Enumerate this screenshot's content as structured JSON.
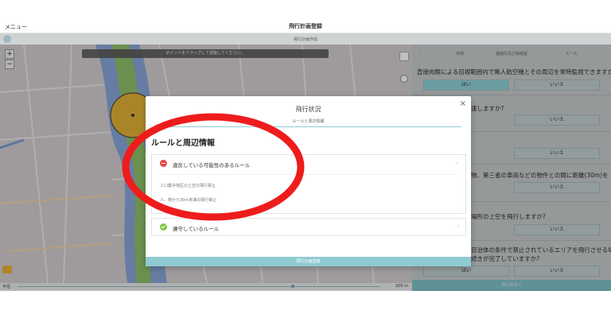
{
  "app": {
    "menu_label": "メニュー",
    "title": "飛行計画登録",
    "subheader": "飛行計画作成"
  },
  "map": {
    "hint": "ポイントをドラッグして調整してください。",
    "zoom_in": "+",
    "zoom_out": "−",
    "slider_label": "半径",
    "distance": "200 m",
    "slider_value_ratio": 0.76
  },
  "panel": {
    "tabs": [
      "日時",
      "連絡先及び操縦者",
      "ルール"
    ],
    "prev": "‹",
    "next": "›",
    "questions": [
      "直接肉眼による目視範囲内で無人航空機とその周辺を常時監視できますか?",
      "速しますか?",
      "物、第三者の車両などの物件との間に距離(30m)を",
      "場所の上空を飛行しますか?",
      "目治体の条件で禁止されているエリアを飛行させる場",
      "続きが完了していますか?"
    ],
    "yes": "はい",
    "no": "いいえ",
    "footer": "飛行状況へ"
  },
  "modal": {
    "close": "×",
    "title": "飛行状況",
    "subtitle": "ルールと周辺情報",
    "heading": "ルールと周辺情報",
    "violating": {
      "label": "違反している可能性のあるルール",
      "rules": [
        "人口集中地区の上空の飛行禁止",
        "人、物から30m未満の飛行禁止"
      ]
    },
    "compliant": {
      "label": "遵守しているルール"
    },
    "submit": "飛行計画登録"
  },
  "colors": {
    "accent": "#8fcbd1",
    "danger": "#e64545",
    "ok": "#82c341",
    "annotation": "#ee1c1c"
  }
}
